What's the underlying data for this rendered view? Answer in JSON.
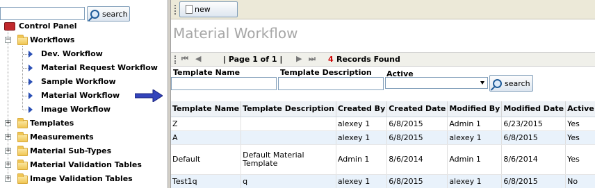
{
  "left": {
    "search": {
      "value": "",
      "button_label": "search"
    },
    "tree": {
      "control_panel": "Control Panel",
      "workflows": "Workflows",
      "workflow_items": [
        "Dev. Workflow",
        "Material Request Workflow",
        "Sample Workflow",
        "Material Workflow",
        "Image Workflow"
      ],
      "folders": [
        "Templates",
        "Measurements",
        "Material Sub-Types",
        "Material Validation Tables",
        "Image Validation Tables"
      ]
    }
  },
  "toolbar": {
    "new_label": "new"
  },
  "page_title": "Material Workflow",
  "pager": {
    "page_label": "| Page 1 of 1 |",
    "records_count": "4",
    "records_label": "Records Found"
  },
  "filters": {
    "template_name_label": "Template Name",
    "template_description_label": "Template Description",
    "active_label": "Active",
    "active_value": "",
    "search_label": "search"
  },
  "grid": {
    "headers": [
      "Template Name",
      "Template Description",
      "Created By",
      "Created Date",
      "Modified By",
      "Modified Date",
      "Active"
    ],
    "rows": [
      [
        "Z",
        "",
        "alexey 1",
        "6/8/2015",
        "Admin 1",
        "6/23/2015",
        "Yes"
      ],
      [
        "A",
        "",
        "alexey 1",
        "6/8/2015",
        "alexey 1",
        "6/8/2015",
        "Yes"
      ],
      [
        "Default",
        "Default Material Template",
        "Admin 1",
        "8/6/2014",
        "Admin 1",
        "8/6/2014",
        "Yes"
      ],
      [
        "Test1q",
        "q",
        "alexey 1",
        "6/8/2015",
        "alexey 1",
        "6/8/2015",
        "No"
      ]
    ]
  },
  "colors": {
    "title": "#a7a7a7",
    "records_count": "#cc0000",
    "tree_arrow": "#2a4fb5",
    "pointer_arrow": "#3344bb"
  }
}
